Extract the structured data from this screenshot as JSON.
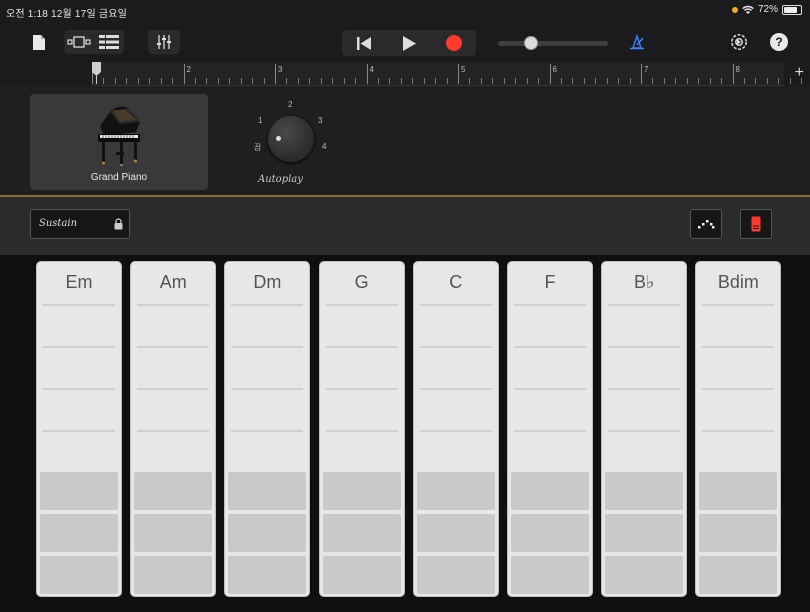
{
  "status_bar": {
    "time": "오전 1:18  12월 17일 금요일",
    "battery": "72%",
    "accent_orange": "#f5a623"
  },
  "toolbar": {
    "icons": [
      "document-icon",
      "view-toggle-icon",
      "tracks-view-icon",
      "mixer-icon",
      "rewind-icon",
      "play-icon",
      "record-icon",
      "metronome-icon",
      "settings-icon",
      "help-icon"
    ],
    "record_color": "#ff3b30",
    "metronome_color": "#3b82f6",
    "help_label": "?",
    "volume_level": 0.3
  },
  "ruler": {
    "bars": [
      "1",
      "2",
      "3",
      "4",
      "5",
      "6",
      "7",
      "8"
    ],
    "add_label": "+"
  },
  "instrument": {
    "name": "Grand Piano",
    "autoplay_label": "Autoplay",
    "knob_labels": {
      "off": "끔",
      "one": "1",
      "two": "2",
      "three": "3",
      "four": "4"
    }
  },
  "controls": {
    "sustain_label": "Sustain",
    "accent_gold": "#8a6d2a"
  },
  "chords": [
    "Em",
    "Am",
    "Dm",
    "G",
    "C",
    "F",
    "B♭",
    "Bdim"
  ]
}
